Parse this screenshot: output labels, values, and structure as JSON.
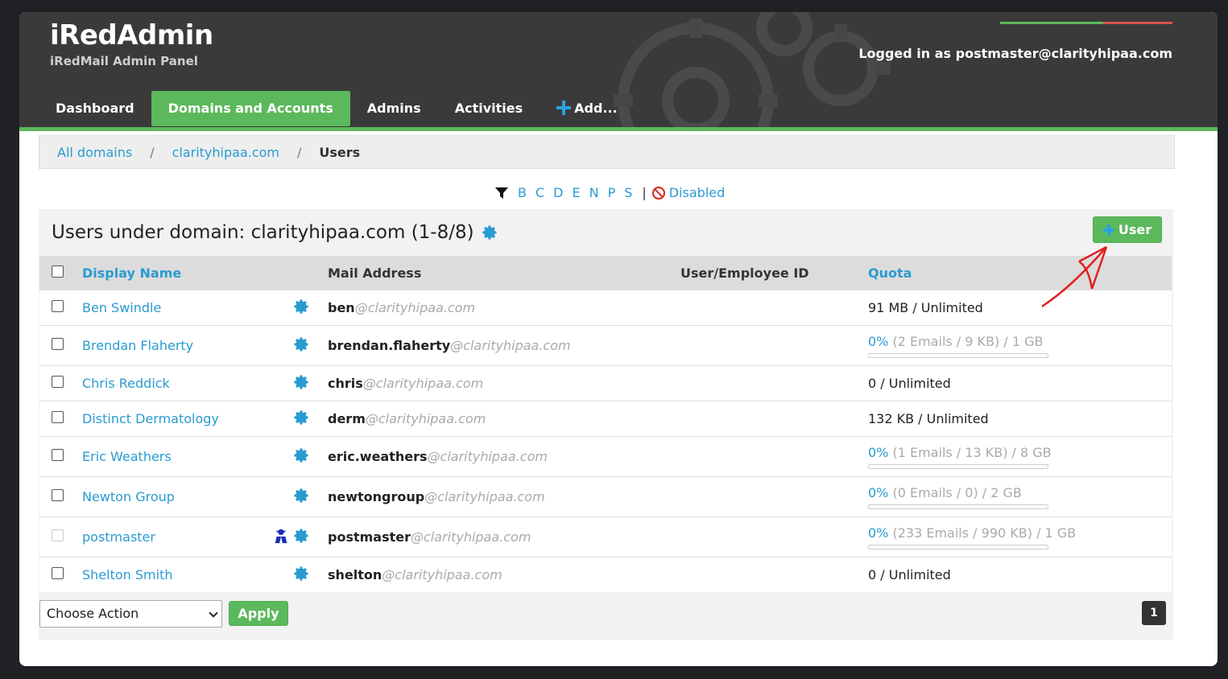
{
  "header": {
    "title": "iRedAdmin",
    "subtitle": "iRedMail Admin Panel",
    "login_info": "Logged in as postmaster@clarityhipaa.com",
    "colors": {
      "accent_green": "#5cb85c",
      "link_blue": "#2a9bd1",
      "header_bg": "#3a3a3a"
    }
  },
  "nav": {
    "items": [
      {
        "label": "Dashboard",
        "active": false
      },
      {
        "label": "Domains and Accounts",
        "active": true
      },
      {
        "label": "Admins",
        "active": false
      },
      {
        "label": "Activities",
        "active": false
      },
      {
        "label": "Add...",
        "active": false,
        "icon": "plus-icon"
      }
    ]
  },
  "breadcrumb": {
    "items": [
      "All domains",
      "clarityhipaa.com",
      "Users"
    ],
    "separator": "/"
  },
  "filter": {
    "icon": "filter-icon",
    "letters": [
      "B",
      "C",
      "D",
      "E",
      "N",
      "P",
      "S"
    ],
    "divider": "|",
    "disabled_label": "Disabled",
    "disabled_icon": "ban-icon"
  },
  "panel": {
    "title": "Users under domain: clarityhipaa.com (1-8/8)",
    "add_user_label": "User"
  },
  "table": {
    "headers": {
      "display_name": "Display Name",
      "mail_address": "Mail Address",
      "employee_id": "User/Employee ID",
      "quota": "Quota"
    },
    "rows": [
      {
        "name": "Ben Swindle",
        "mail_user": "ben",
        "mail_domain": "@clarityhipaa.com",
        "quota_type": "plain",
        "quota": "91 MB / Unlimited",
        "admin": false,
        "checkbox_disabled": false
      },
      {
        "name": "Brendan Flaherty",
        "mail_user": "brendan.flaherty",
        "mail_domain": "@clarityhipaa.com",
        "quota_type": "bar",
        "quota_pct": "0%",
        "quota_rest": "(2 Emails / 9 KB) / 1 GB",
        "admin": false,
        "checkbox_disabled": false
      },
      {
        "name": "Chris Reddick",
        "mail_user": "chris",
        "mail_domain": "@clarityhipaa.com",
        "quota_type": "plain",
        "quota": "0 / Unlimited",
        "admin": false,
        "checkbox_disabled": false
      },
      {
        "name": "Distinct Dermatology",
        "mail_user": "derm",
        "mail_domain": "@clarityhipaa.com",
        "quota_type": "plain",
        "quota": "132 KB / Unlimited",
        "admin": false,
        "checkbox_disabled": false
      },
      {
        "name": "Eric Weathers",
        "mail_user": "eric.weathers",
        "mail_domain": "@clarityhipaa.com",
        "quota_type": "bar",
        "quota_pct": "0%",
        "quota_rest": "(1 Emails / 13 KB) / 8 GB",
        "admin": false,
        "checkbox_disabled": false
      },
      {
        "name": "Newton Group",
        "mail_user": "newtongroup",
        "mail_domain": "@clarityhipaa.com",
        "quota_type": "bar",
        "quota_pct": "0%",
        "quota_rest": "(0 Emails / 0) / 2 GB",
        "admin": false,
        "checkbox_disabled": false
      },
      {
        "name": "postmaster",
        "mail_user": "postmaster",
        "mail_domain": "@clarityhipaa.com",
        "quota_type": "bar",
        "quota_pct": "0%",
        "quota_rest": "(233 Emails / 990 KB) / 1 GB",
        "admin": true,
        "checkbox_disabled": true
      },
      {
        "name": "Shelton Smith",
        "mail_user": "shelton",
        "mail_domain": "@clarityhipaa.com",
        "quota_type": "plain",
        "quota": "0 / Unlimited",
        "admin": false,
        "checkbox_disabled": false
      }
    ]
  },
  "footer": {
    "action_select": "Choose Action",
    "apply_label": "Apply",
    "page": "1"
  }
}
